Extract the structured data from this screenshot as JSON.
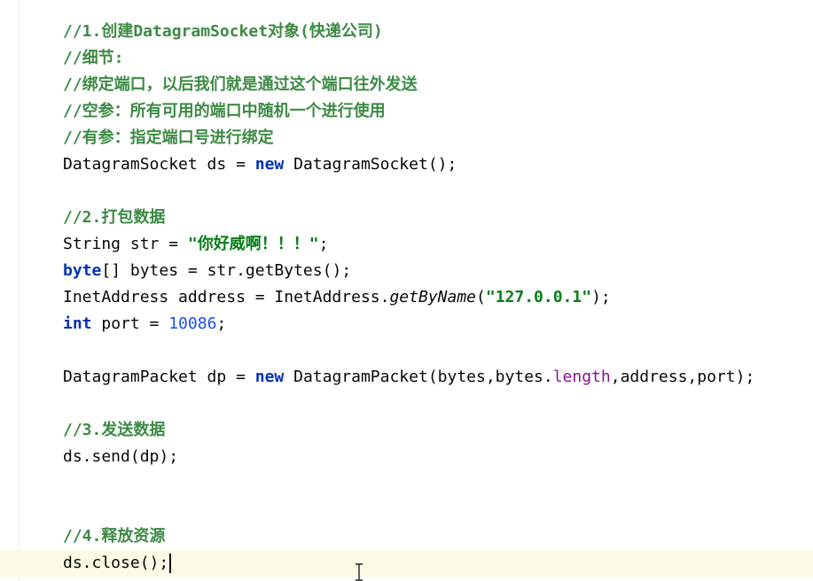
{
  "editor": {
    "lines": [
      {
        "comment": "//1.创建DatagramSocket对象(快递公司)"
      },
      {
        "comment": "//细节:"
      },
      {
        "comment": "//绑定端口，以后我们就是通过这个端口往外发送"
      },
      {
        "comment": "//空参：所有可用的端口中随机一个进行使用"
      },
      {
        "comment": "//有参：指定端口号进行绑定"
      },
      {
        "p1": "DatagramSocket ds = ",
        "kw": "new",
        "p2": " DatagramSocket();"
      },
      {},
      {
        "comment": "//2.打包数据"
      },
      {
        "p1": "String str = ",
        "str": "\"你好威啊！！！\"",
        "p2": ";"
      },
      {
        "kw": "byte",
        "p1": "[] bytes = str.getBytes();"
      },
      {
        "p1": "InetAddress address = InetAddress.",
        "method": "getByName",
        "p2": "(",
        "str": "\"127.0.0.1\"",
        "p3": ");"
      },
      {
        "kw": "int",
        "p1": " port = ",
        "num": "10086",
        "p2": ";"
      },
      {},
      {
        "p1": "DatagramPacket dp = ",
        "kw": "new",
        "p2": " DatagramPacket(bytes,bytes.",
        "field": "length",
        "p3": ",address,port);"
      },
      {},
      {
        "comment": "//3.发送数据"
      },
      {
        "p1": "ds.send(dp);"
      },
      {},
      {},
      {
        "comment": "//4.释放资源"
      },
      {
        "p1": "ds.close();"
      }
    ],
    "colors": {
      "comment": "#3c8a44",
      "keyword": "#0033b3",
      "string": "#067d17",
      "number": "#1750eb",
      "field": "#871094",
      "caret_row": "#fcfae6"
    },
    "cursor_icon": "text-cursor-icon"
  }
}
